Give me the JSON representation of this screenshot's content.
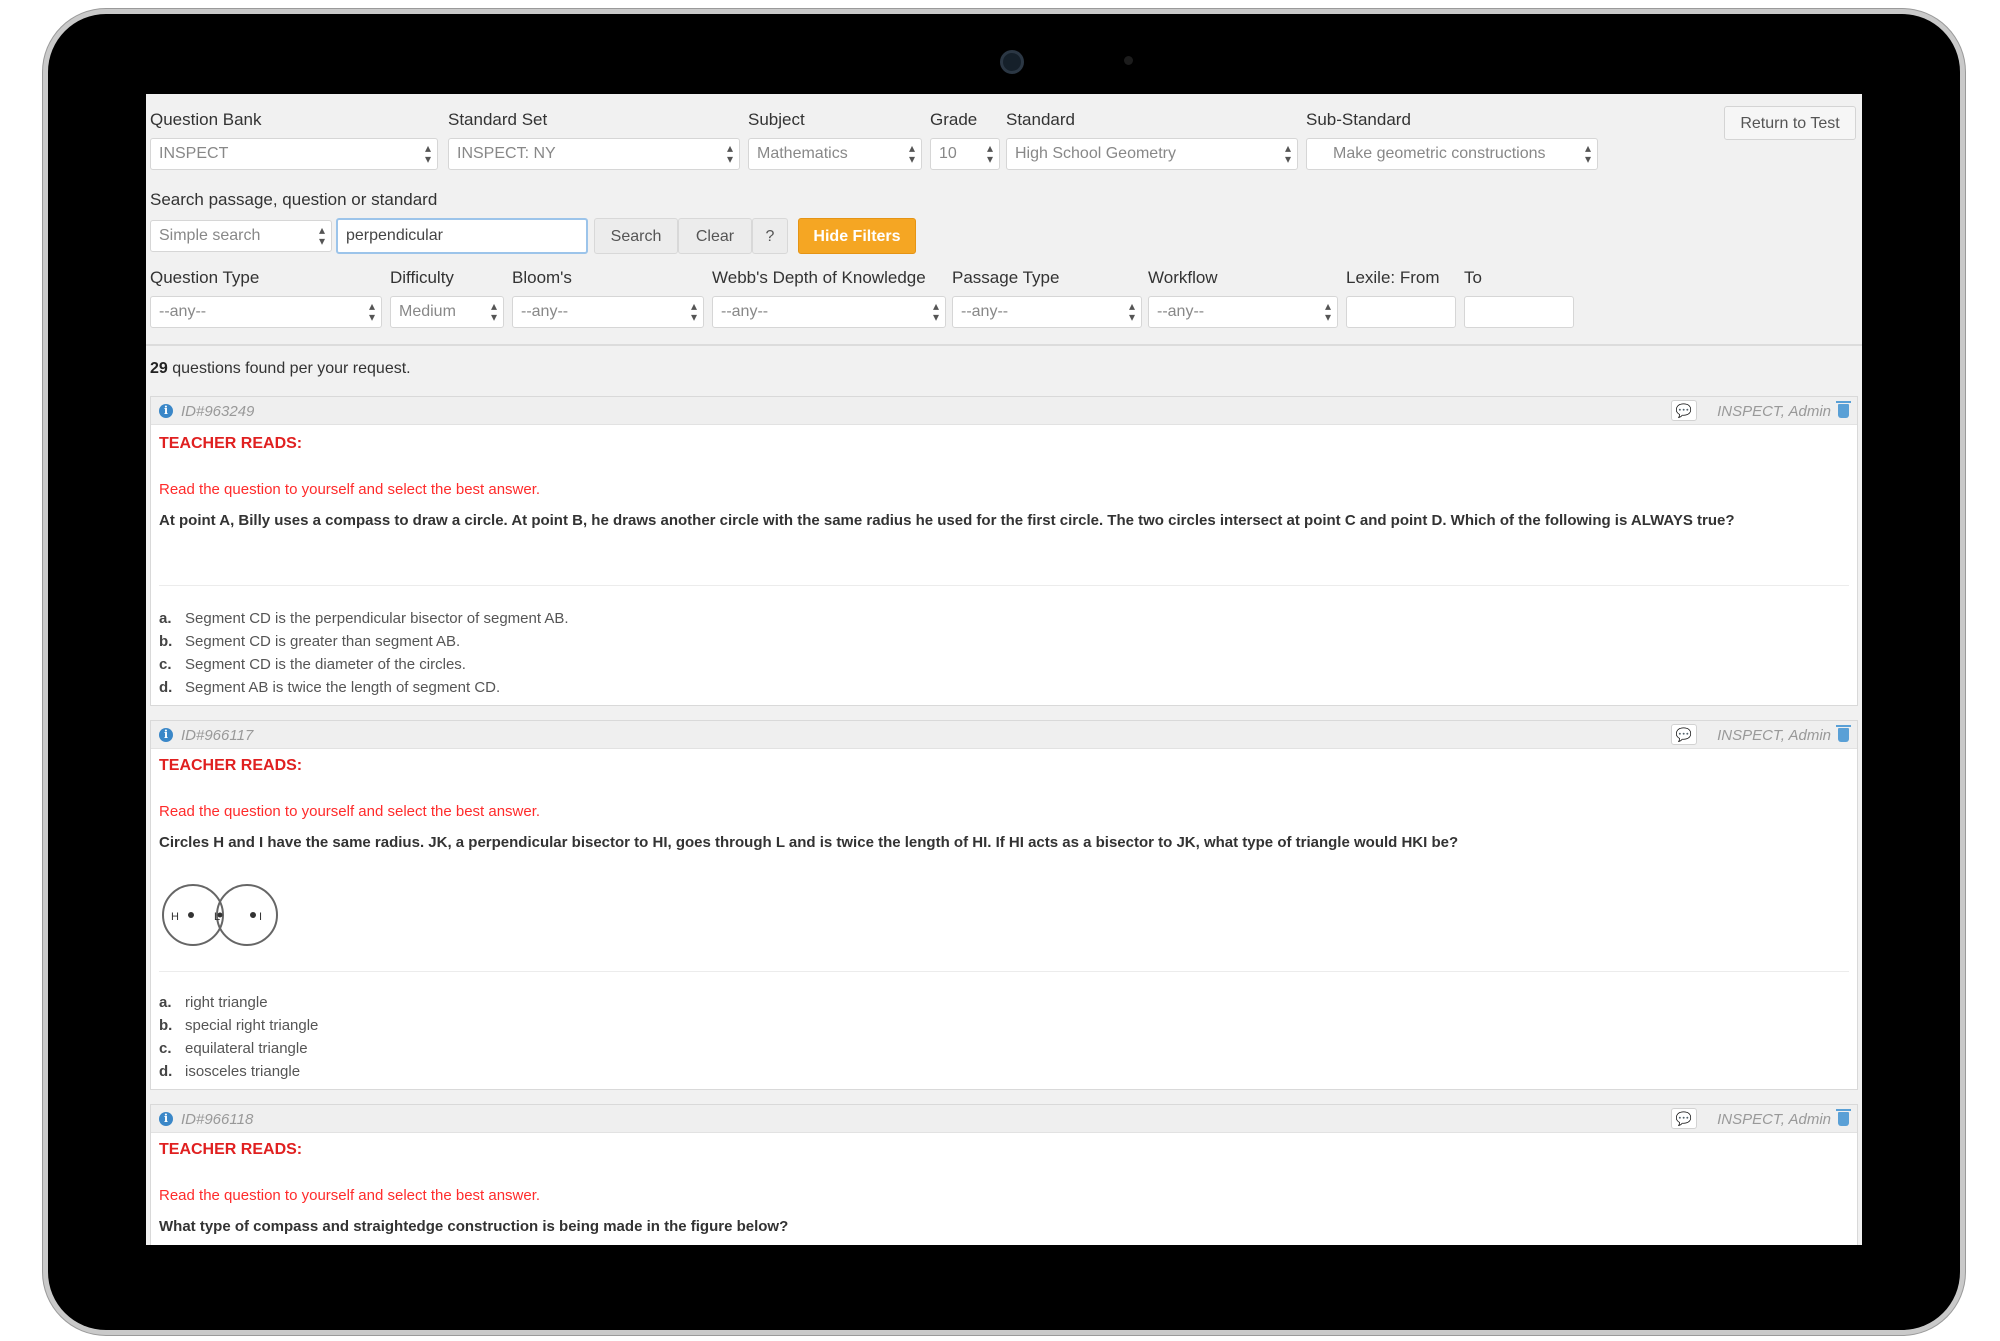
{
  "filters": {
    "question_bank": {
      "label": "Question Bank",
      "value": "INSPECT"
    },
    "standard_set": {
      "label": "Standard Set",
      "value": "INSPECT: NY"
    },
    "subject": {
      "label": "Subject",
      "value": "Mathematics"
    },
    "grade": {
      "label": "Grade",
      "value": "10"
    },
    "standard": {
      "label": "Standard",
      "value": "High School Geometry"
    },
    "sub_standard": {
      "label": "Sub-Standard",
      "value": "Make geometric constructions"
    },
    "return_button": "Return to Test",
    "search_label": "Search passage, question or standard",
    "search_mode": "Simple search",
    "search_value": "perpendicular",
    "search_button": "Search",
    "clear_button": "Clear",
    "help_button": "?",
    "hide_filters_button": "Hide Filters",
    "question_type": {
      "label": "Question Type",
      "value": "--any--"
    },
    "difficulty": {
      "label": "Difficulty",
      "value": "Medium"
    },
    "blooms": {
      "label": "Bloom's",
      "value": "--any--"
    },
    "webbs": {
      "label": "Webb's Depth of Knowledge",
      "value": "--any--"
    },
    "passage_type": {
      "label": "Passage Type",
      "value": "--any--"
    },
    "workflow": {
      "label": "Workflow",
      "value": "--any--"
    },
    "lexile_from_label": "Lexile: From",
    "lexile_to_label": "To"
  },
  "results": {
    "count": "29",
    "count_suffix": " questions found per your request."
  },
  "questions": [
    {
      "id": "ID#963249",
      "author": "INSPECT, Admin",
      "teacher_reads": "TEACHER READS:",
      "instruction": "Read the question to yourself and select the best answer.",
      "stem": "At point A, Billy uses a compass to draw a circle. At point B, he draws another circle with the same radius he used for the first circle. The two circles intersect at point C and point D. Which of the following is ALWAYS true?",
      "choices": [
        {
          "letter": "a.",
          "text": "Segment CD is the perpendicular bisector of segment AB."
        },
        {
          "letter": "b.",
          "text": "Segment CD is greater than segment AB."
        },
        {
          "letter": "c.",
          "text": "Segment CD is the diameter of the circles."
        },
        {
          "letter": "d.",
          "text": "Segment AB is twice the length of segment CD."
        }
      ]
    },
    {
      "id": "ID#966117",
      "author": "INSPECT, Admin",
      "teacher_reads": "TEACHER READS:",
      "instruction": "Read the question to yourself and select the best answer.",
      "stem": "Circles H and I have the same radius. JK, a perpendicular bisector to HI, goes through L and is twice the length of HI. If HI acts as a bisector to JK, what type of triangle would HKI be?",
      "figure_labels": {
        "h": "H",
        "l": "L",
        "i": "I"
      },
      "choices": [
        {
          "letter": "a.",
          "text": "right triangle"
        },
        {
          "letter": "b.",
          "text": "special right triangle"
        },
        {
          "letter": "c.",
          "text": "equilateral triangle"
        },
        {
          "letter": "d.",
          "text": "isosceles triangle"
        }
      ]
    },
    {
      "id": "ID#966118",
      "author": "INSPECT, Admin",
      "teacher_reads": "TEACHER READS:",
      "instruction": "Read the question to yourself and select the best answer.",
      "stem": "What type of compass and straightedge construction is being made in the figure below?"
    }
  ]
}
